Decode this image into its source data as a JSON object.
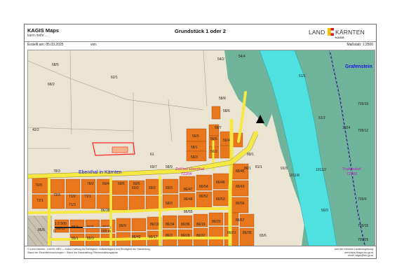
{
  "header": {
    "app_title": "KAGIS Maps",
    "app_subtitle": "kann mehr ...",
    "document_title": "Grundstück 1 oder 2",
    "logo_land": "LAND",
    "logo_kaernten": "KÄRNTEN",
    "logo_sub": "KAGIS"
  },
  "meta": {
    "created_label": "Erstellt am: 05.03.2025",
    "from_label": "von:",
    "scale_label": "Maßstab: 1:2500"
  },
  "map": {
    "place_names": {
      "ebenthal": "Ebenthal in Kärnten",
      "grafenstein": "Grafenstein",
      "truttendorf": "Truttendorf",
      "truttendorf_code": "72160",
      "zell_line1": "Zell bei Ebenthal",
      "zell_code": "72204"
    },
    "parcels": [
      "54/4",
      "54/2",
      "68/5",
      "68/2",
      "62/1",
      "58/6",
      "58/8",
      "42/2",
      "56/7",
      "56/5",
      "56/6",
      "56/4",
      "58/1",
      "56/2",
      "58/3",
      "61",
      "78/3",
      "78/2",
      "69/4",
      "69/5",
      "69/6",
      "69/7",
      "58/9",
      "89/1",
      "86/1",
      "81/1",
      "91/3",
      "1011/8",
      "1011/2",
      "51/2",
      "50/3",
      "1024",
      "51/1",
      "709/10",
      "709/12",
      "709/9",
      "709/15",
      "709/26",
      "70/3",
      "73/3",
      "72/1",
      "71/2",
      "71/3",
      "71/1",
      "60/2",
      "59/2",
      "58/3",
      "59/3",
      "86/47",
      "86/48",
      "86/46",
      "86/45",
      "86/43",
      "86/52",
      "86/53",
      "86/54",
      "86/55",
      "86/56",
      "86/57",
      "86/34",
      "86/10",
      "86/9",
      "86/7",
      "86/5",
      "86/4",
      "86/3",
      "86/18",
      "86/19",
      "86/20",
      "86/21",
      "86/35",
      "86/36",
      "86/37",
      "86/38",
      "86/42",
      "86/17",
      "86/13",
      "85/1",
      "85/3",
      "85/6",
      "65/6",
      "90/2"
    ],
    "scale_bar": "1:2.500",
    "scale_zero": "0",
    "scale_end": "100 m",
    "north_marker": "north-arrow"
  },
  "footer": {
    "disclaimer_1": "© Land Kärnten - KAGIS, BEV — Keine Haftung für Richtigkeit, Vollständigkeit und Richtigkeit der Darstellung.",
    "disclaimer_2": "Stand der Ersichtlichmachungen = Stand der Beschaffung Flächenwidmungsplan",
    "contact_1": "Amt der Kärntner Landesregierung",
    "contact_2": "web:https://kagis.ktn.gv.at",
    "contact_3": "email: kagis@ktn.gv.at"
  },
  "colors": {
    "parcel_fill": "#e8761c",
    "road": "#f5e842",
    "river": "#4fe0e0",
    "forest": "#6fb39a",
    "meadow": "#ece4d3",
    "highlight_outline": "#ff2020",
    "place_label": "#1a1ad8",
    "cadastral_label": "#c014c0"
  }
}
